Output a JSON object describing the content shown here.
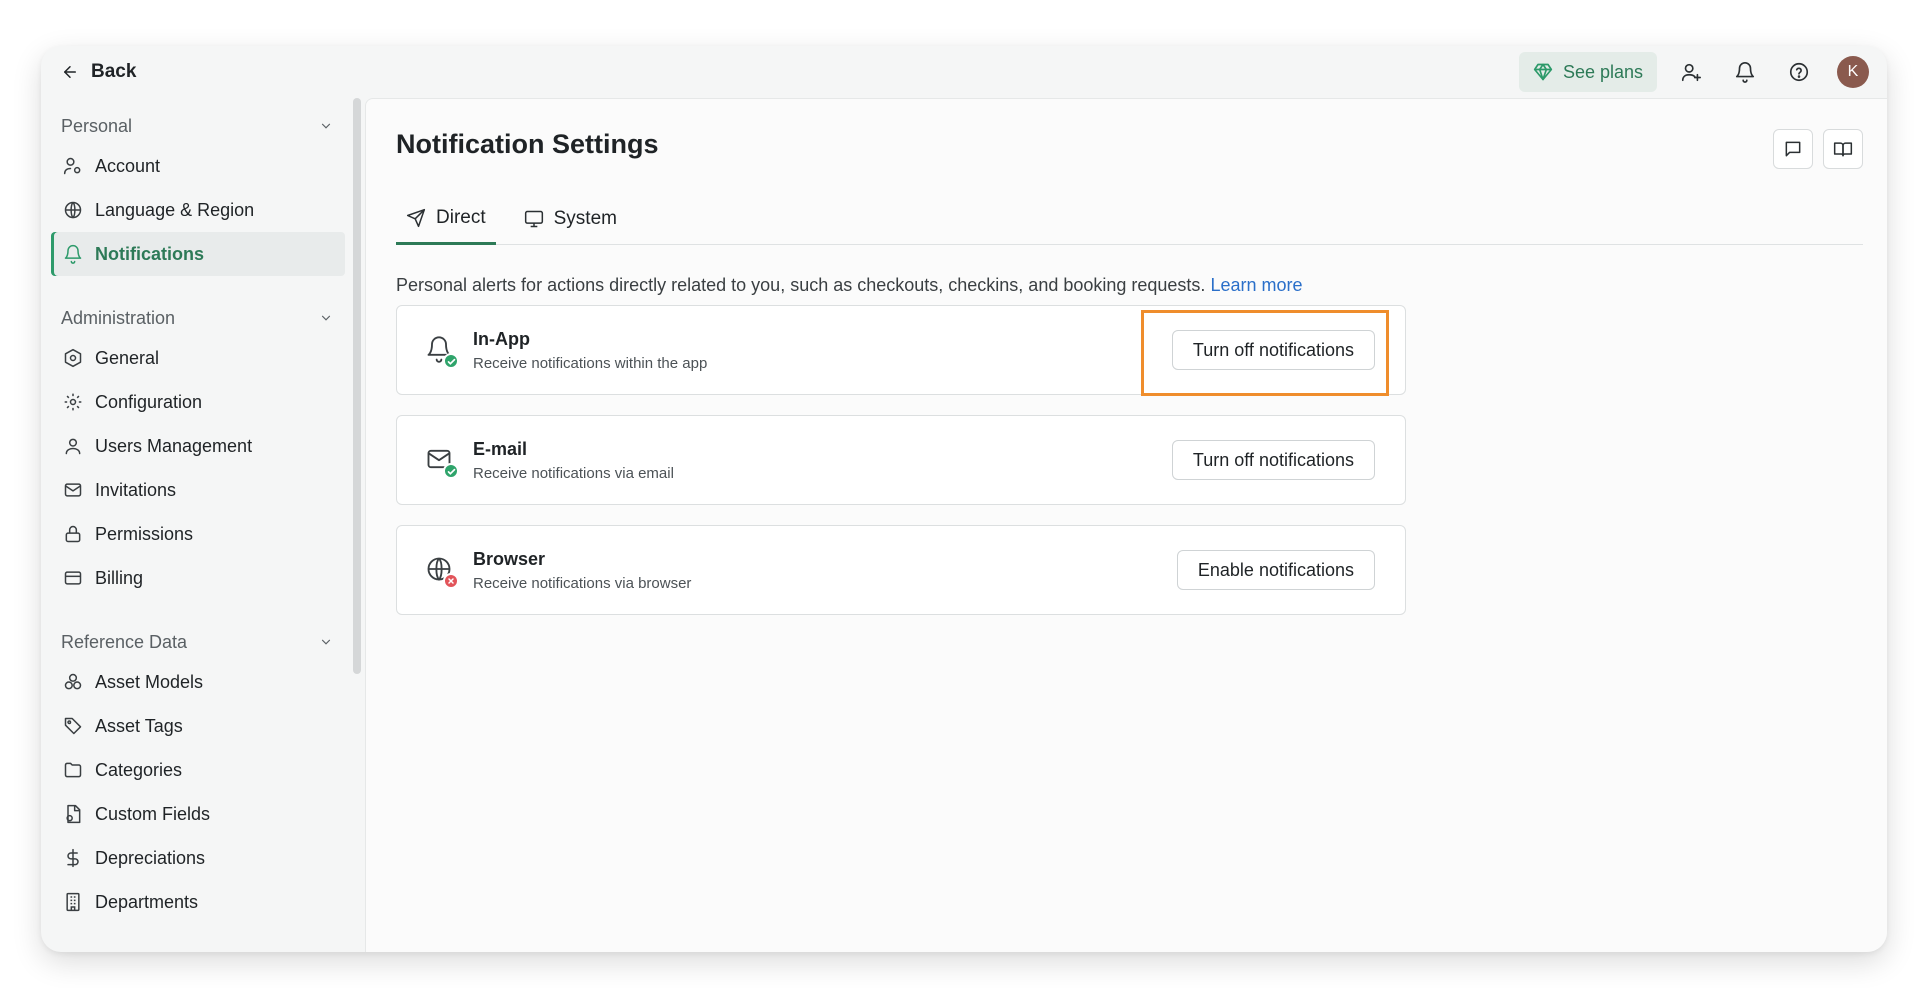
{
  "topbar": {
    "back_label": "Back",
    "see_plans_label": "See plans",
    "avatar_initial": "K"
  },
  "sidebar": {
    "sections": [
      {
        "title": "Personal",
        "items": [
          {
            "label": "Account",
            "icon": "user-cog-icon"
          },
          {
            "label": "Language & Region",
            "icon": "globe-icon"
          },
          {
            "label": "Notifications",
            "icon": "bell-icon",
            "active": true
          }
        ]
      },
      {
        "title": "Administration",
        "items": [
          {
            "label": "General",
            "icon": "hexagon-icon"
          },
          {
            "label": "Configuration",
            "icon": "gear-icon"
          },
          {
            "label": "Users Management",
            "icon": "user-icon"
          },
          {
            "label": "Invitations",
            "icon": "mail-icon"
          },
          {
            "label": "Permissions",
            "icon": "lock-icon"
          },
          {
            "label": "Billing",
            "icon": "credit-card-icon"
          }
        ]
      },
      {
        "title": "Reference Data",
        "items": [
          {
            "label": "Asset Models",
            "icon": "boxes-icon"
          },
          {
            "label": "Asset Tags",
            "icon": "tag-icon"
          },
          {
            "label": "Categories",
            "icon": "folder-icon"
          },
          {
            "label": "Custom Fields",
            "icon": "file-code-icon"
          },
          {
            "label": "Depreciations",
            "icon": "dollar-icon"
          },
          {
            "label": "Departments",
            "icon": "building-icon"
          }
        ]
      }
    ]
  },
  "main": {
    "title": "Notification Settings",
    "tabs": [
      {
        "label": "Direct",
        "icon": "send-icon",
        "active": true
      },
      {
        "label": "System",
        "icon": "monitor-icon",
        "active": false
      }
    ],
    "intro_text": "Personal alerts for actions directly related to you, such as checkouts, checkins, and booking requests.",
    "learn_more": "Learn more",
    "channels": [
      {
        "title": "In-App",
        "desc": "Receive notifications within the app",
        "button": "Turn off notifications",
        "status": "enabled"
      },
      {
        "title": "E-mail",
        "desc": "Receive notifications via email",
        "button": "Turn off notifications",
        "status": "enabled"
      },
      {
        "title": "Browser",
        "desc": "Receive notifications via browser",
        "button": "Enable notifications",
        "status": "disabled"
      }
    ]
  },
  "colors": {
    "accent": "#2d7a57",
    "highlight": "#ef8d2c",
    "status_ok": "#2fa46b",
    "status_off": "#e2545a",
    "link": "#2a6fc9"
  }
}
